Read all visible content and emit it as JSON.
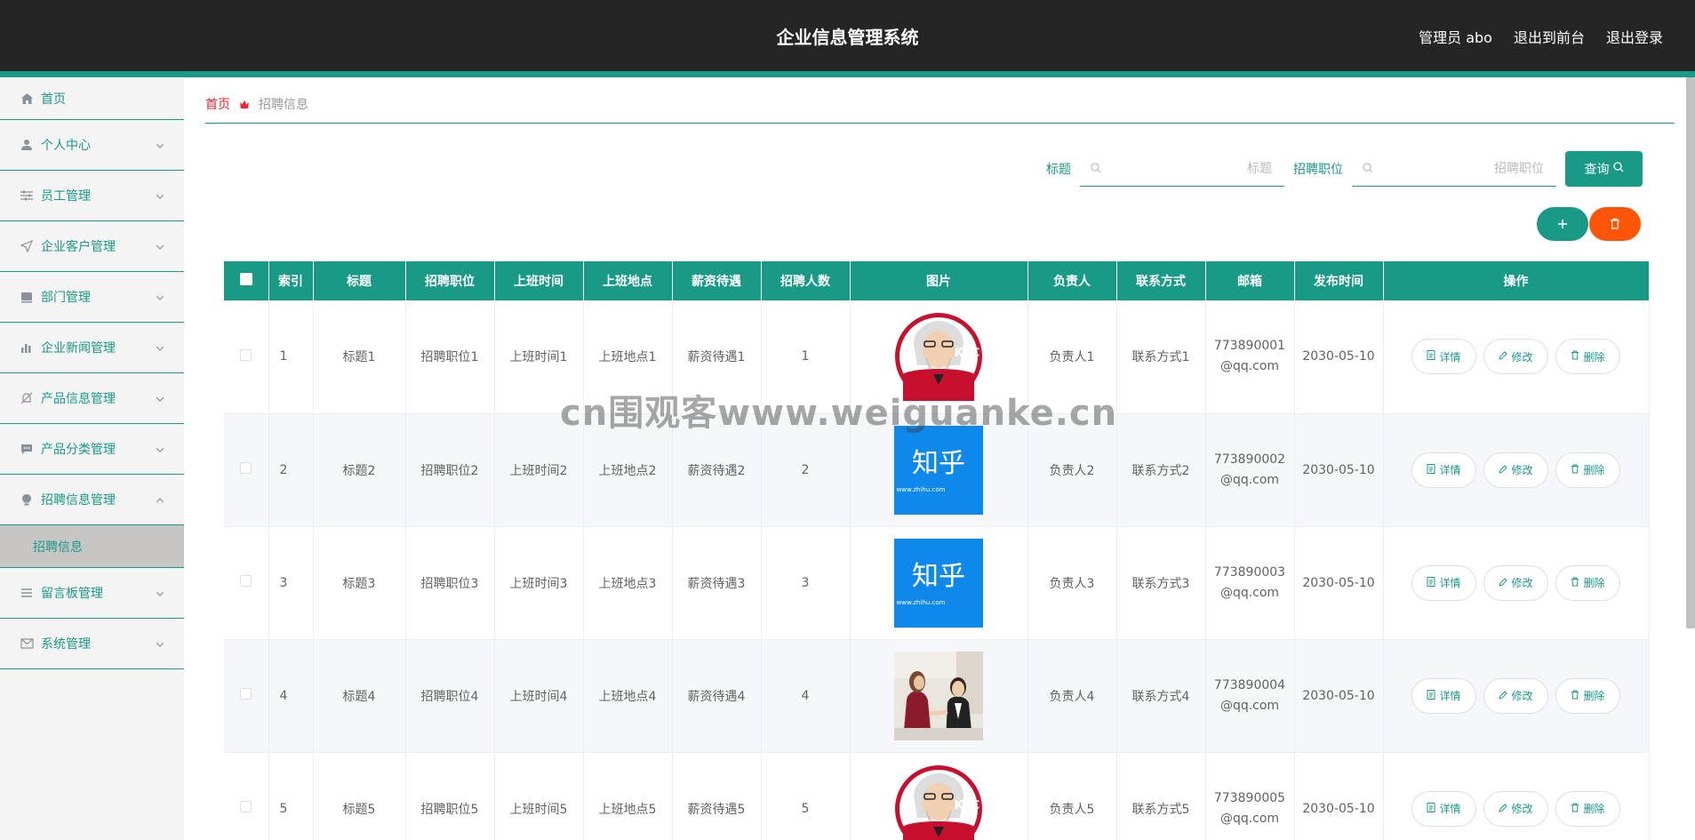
{
  "header": {
    "title": "企业信息管理系统",
    "admin": "管理员 abo",
    "to_front": "退出到前台",
    "logout": "退出登录"
  },
  "sidebar": {
    "items": [
      {
        "label": "首页",
        "icon": "home-icon"
      },
      {
        "label": "个人中心",
        "icon": "user-icon"
      },
      {
        "label": "员工管理",
        "icon": "sliders-icon"
      },
      {
        "label": "企业客户管理",
        "icon": "send-icon"
      },
      {
        "label": "部门管理",
        "icon": "folder-icon"
      },
      {
        "label": "企业新闻管理",
        "icon": "bar-chart-icon"
      },
      {
        "label": "产品信息管理",
        "icon": "bell-off-icon"
      },
      {
        "label": "产品分类管理",
        "icon": "chat-icon"
      },
      {
        "label": "招聘信息管理",
        "icon": "bulb-icon"
      },
      {
        "label": "留言板管理",
        "icon": "list-icon"
      },
      {
        "label": "系统管理",
        "icon": "mail-icon"
      }
    ],
    "sub_active": "招聘信息"
  },
  "breadcrumb": {
    "home": "首页",
    "current": "招聘信息"
  },
  "search": {
    "title_label": "标题",
    "title_placeholder": "标题",
    "position_label": "招聘职位",
    "position_placeholder": "招聘职位",
    "query_label": "查询"
  },
  "table": {
    "headers": [
      "索引",
      "标题",
      "招聘职位",
      "上班时间",
      "上班地点",
      "薪资待遇",
      "招聘人数",
      "图片",
      "负责人",
      "联系方式",
      "邮箱",
      "发布时间",
      "操作"
    ],
    "rows": [
      {
        "idx": "1",
        "title": "标题1",
        "position": "招聘职位1",
        "time": "上班时间1",
        "place": "上班地点1",
        "salary": "薪资待遇1",
        "count": "1",
        "image": "kfc",
        "owner": "负责人1",
        "contact": "联系方式1",
        "email1": "773890001",
        "email2": "@qq.com",
        "date": "2030-05-10"
      },
      {
        "idx": "2",
        "title": "标题2",
        "position": "招聘职位2",
        "time": "上班时间2",
        "place": "上班地点2",
        "salary": "薪资待遇2",
        "count": "2",
        "image": "zhihu",
        "owner": "负责人2",
        "contact": "联系方式2",
        "email1": "773890002",
        "email2": "@qq.com",
        "date": "2030-05-10"
      },
      {
        "idx": "3",
        "title": "标题3",
        "position": "招聘职位3",
        "time": "上班时间3",
        "place": "上班地点3",
        "salary": "薪资待遇3",
        "count": "3",
        "image": "zhihu",
        "owner": "负责人3",
        "contact": "联系方式3",
        "email1": "773890003",
        "email2": "@qq.com",
        "date": "2030-05-10"
      },
      {
        "idx": "4",
        "title": "标题4",
        "position": "招聘职位4",
        "time": "上班时间4",
        "place": "上班地点4",
        "salary": "薪资待遇4",
        "count": "4",
        "image": "meeting",
        "owner": "负责人4",
        "contact": "联系方式4",
        "email1": "773890004",
        "email2": "@qq.com",
        "date": "2030-05-10"
      },
      {
        "idx": "5",
        "title": "标题5",
        "position": "招聘职位5",
        "time": "上班时间5",
        "place": "上班地点5",
        "salary": "薪资待遇5",
        "count": "5",
        "image": "kfc",
        "owner": "负责人5",
        "contact": "联系方式5",
        "email1": "773890005",
        "email2": "@qq.com",
        "date": "2030-05-10"
      }
    ],
    "ops": {
      "detail": "详情",
      "edit": "修改",
      "delete": "删除"
    }
  },
  "images": {
    "kfc_text": "KFC",
    "zhihu_text": "知乎",
    "zhihu_url": "www.zhihu.com"
  },
  "watermark": "cn围观客www.weiguanke.cn",
  "colors": {
    "accent": "#199a86",
    "danger": "#ff5508",
    "header": "#252525"
  }
}
